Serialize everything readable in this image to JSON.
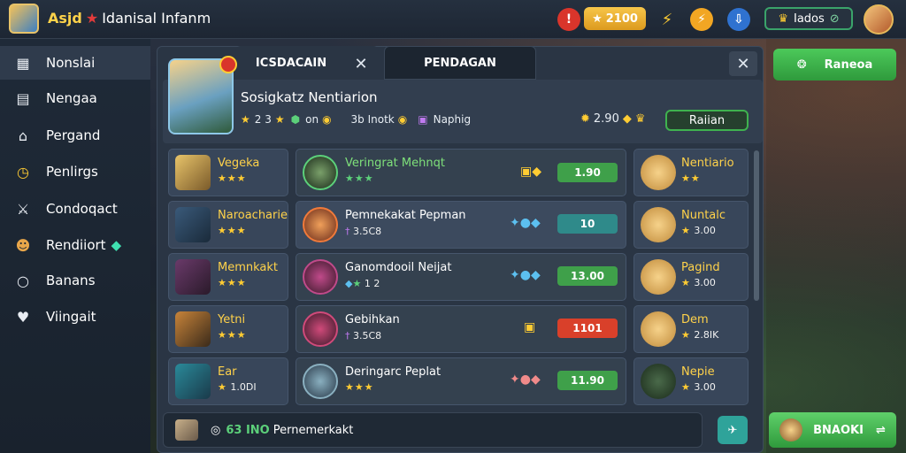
{
  "app": {
    "title_a": "Asjd",
    "title_b": "Idanisal Infanm"
  },
  "topbar": {
    "coins": "2100",
    "profile_label": "Iados"
  },
  "sidebar": {
    "items": [
      {
        "label": "Nonslai",
        "icon": "grid-icon"
      },
      {
        "label": "Nengaa",
        "icon": "book-icon"
      },
      {
        "label": "Pergand",
        "icon": "chest-icon"
      },
      {
        "label": "Penlirgs",
        "icon": "clock-icon"
      },
      {
        "label": "Condoqact",
        "icon": "sword-icon"
      },
      {
        "label": "Rendiiort",
        "icon": "hero-icon"
      },
      {
        "label": "Banans",
        "icon": "circle-icon"
      },
      {
        "label": "Viingait",
        "icon": "shield-icon"
      }
    ]
  },
  "tabs": [
    {
      "label": "ICSDACAIN"
    },
    {
      "label": "PENDAGAN"
    }
  ],
  "header": {
    "name": "Sosigkatz Nentiarion",
    "stat1": "2 3",
    "stat2": "on",
    "stat3": "3b Inotk",
    "stat4": "Naphig",
    "power": "2.90",
    "action": "Raiian"
  },
  "top_action": "Raneoa",
  "left_col": [
    {
      "name": "Vegeka",
      "stat": ""
    },
    {
      "name": "Naroacharie",
      "stat": ""
    },
    {
      "name": "Memnkakt",
      "stat": ""
    },
    {
      "name": "Yetni",
      "stat": ""
    },
    {
      "name": "Ear",
      "stat": "1.0DI"
    }
  ],
  "mid_col": [
    {
      "name": "Veringrat Mehnqt",
      "stat": "",
      "value": "1.90"
    },
    {
      "name": "Pemnekakat Pepman",
      "stat": "3.5C8",
      "value": "10"
    },
    {
      "name": "Ganomdooil Neijat",
      "stat": "1 2",
      "value": "13.00"
    },
    {
      "name": "Gebihkan",
      "stat": "3.5C8",
      "value": "1101"
    },
    {
      "name": "Deringarc Peplat",
      "stat": "",
      "value": "11.90"
    }
  ],
  "right_col": [
    {
      "name": "Nentiario",
      "stat": ""
    },
    {
      "name": "Nuntalc",
      "stat": "3.00"
    },
    {
      "name": "Pagind",
      "stat": "3.00"
    },
    {
      "name": "Dem",
      "stat": "2.8IK"
    },
    {
      "name": "Nepie",
      "stat": "3.00"
    }
  ],
  "bottom": {
    "prefix": "63 INO",
    "text": "Pernemerkakt",
    "action": "BNAOKI"
  },
  "colors": {
    "gold": "#ffd24a",
    "green": "#3fb24f",
    "red": "#e0422e",
    "panel": "#2a3544"
  }
}
